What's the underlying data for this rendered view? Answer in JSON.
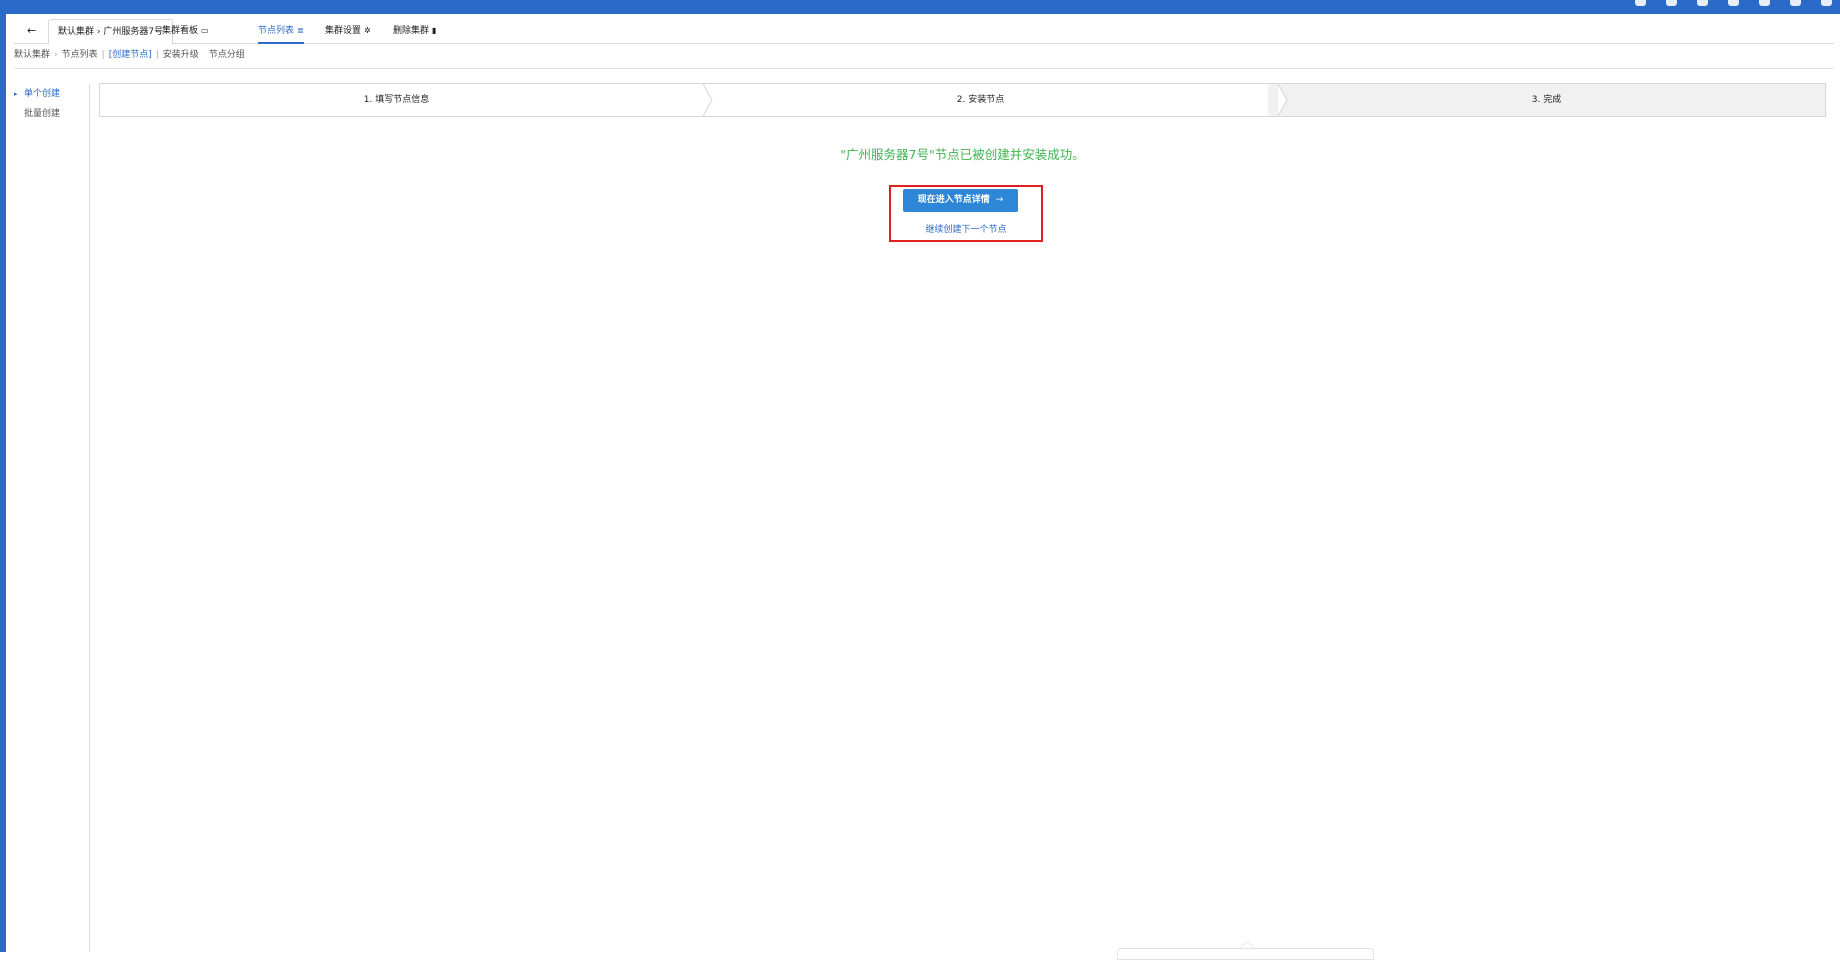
{
  "header": {
    "icons": [
      "location-icon",
      "globe-icon",
      "bell-icon",
      "user-icon",
      "book-icon",
      "theme-icon",
      "logout-icon"
    ]
  },
  "tabs": {
    "back_label": "←",
    "current_label": "默认集群 › 广州服务器7号",
    "items": [
      {
        "label": "集群看板",
        "icon": "chart-icon",
        "glyph": "▭"
      },
      {
        "label": "节点列表",
        "icon": "list-icon",
        "glyph": "≣"
      },
      {
        "label": "集群设置",
        "icon": "gear-icon",
        "glyph": "✲"
      },
      {
        "label": "删除集群",
        "icon": "trash-icon",
        "glyph": "▮"
      }
    ]
  },
  "breadcrumb": {
    "cluster": "默认集群",
    "separator": "›",
    "node_list": "节点列表",
    "pipe": "|",
    "create_node": "[创建节点]",
    "install_upgrade": "安装升级",
    "node_group": "节点分组"
  },
  "sidebar": {
    "items": [
      {
        "label": "单个创建",
        "active": true
      },
      {
        "label": "批量创建",
        "active": false
      }
    ]
  },
  "steps": [
    {
      "label": "1. 填写节点信息"
    },
    {
      "label": "2. 安装节点"
    },
    {
      "label": "3. 完成"
    }
  ],
  "result": {
    "message": "\"广州服务器7号\"节点已被创建并安装成功。",
    "primary_button": "现在进入节点详情",
    "primary_arrow": "→",
    "secondary_link": "继续创建下一个节点"
  },
  "colors": {
    "brand_blue": "#2a6bc9",
    "success_green": "#3fb34f",
    "highlight_red": "#e02020"
  }
}
